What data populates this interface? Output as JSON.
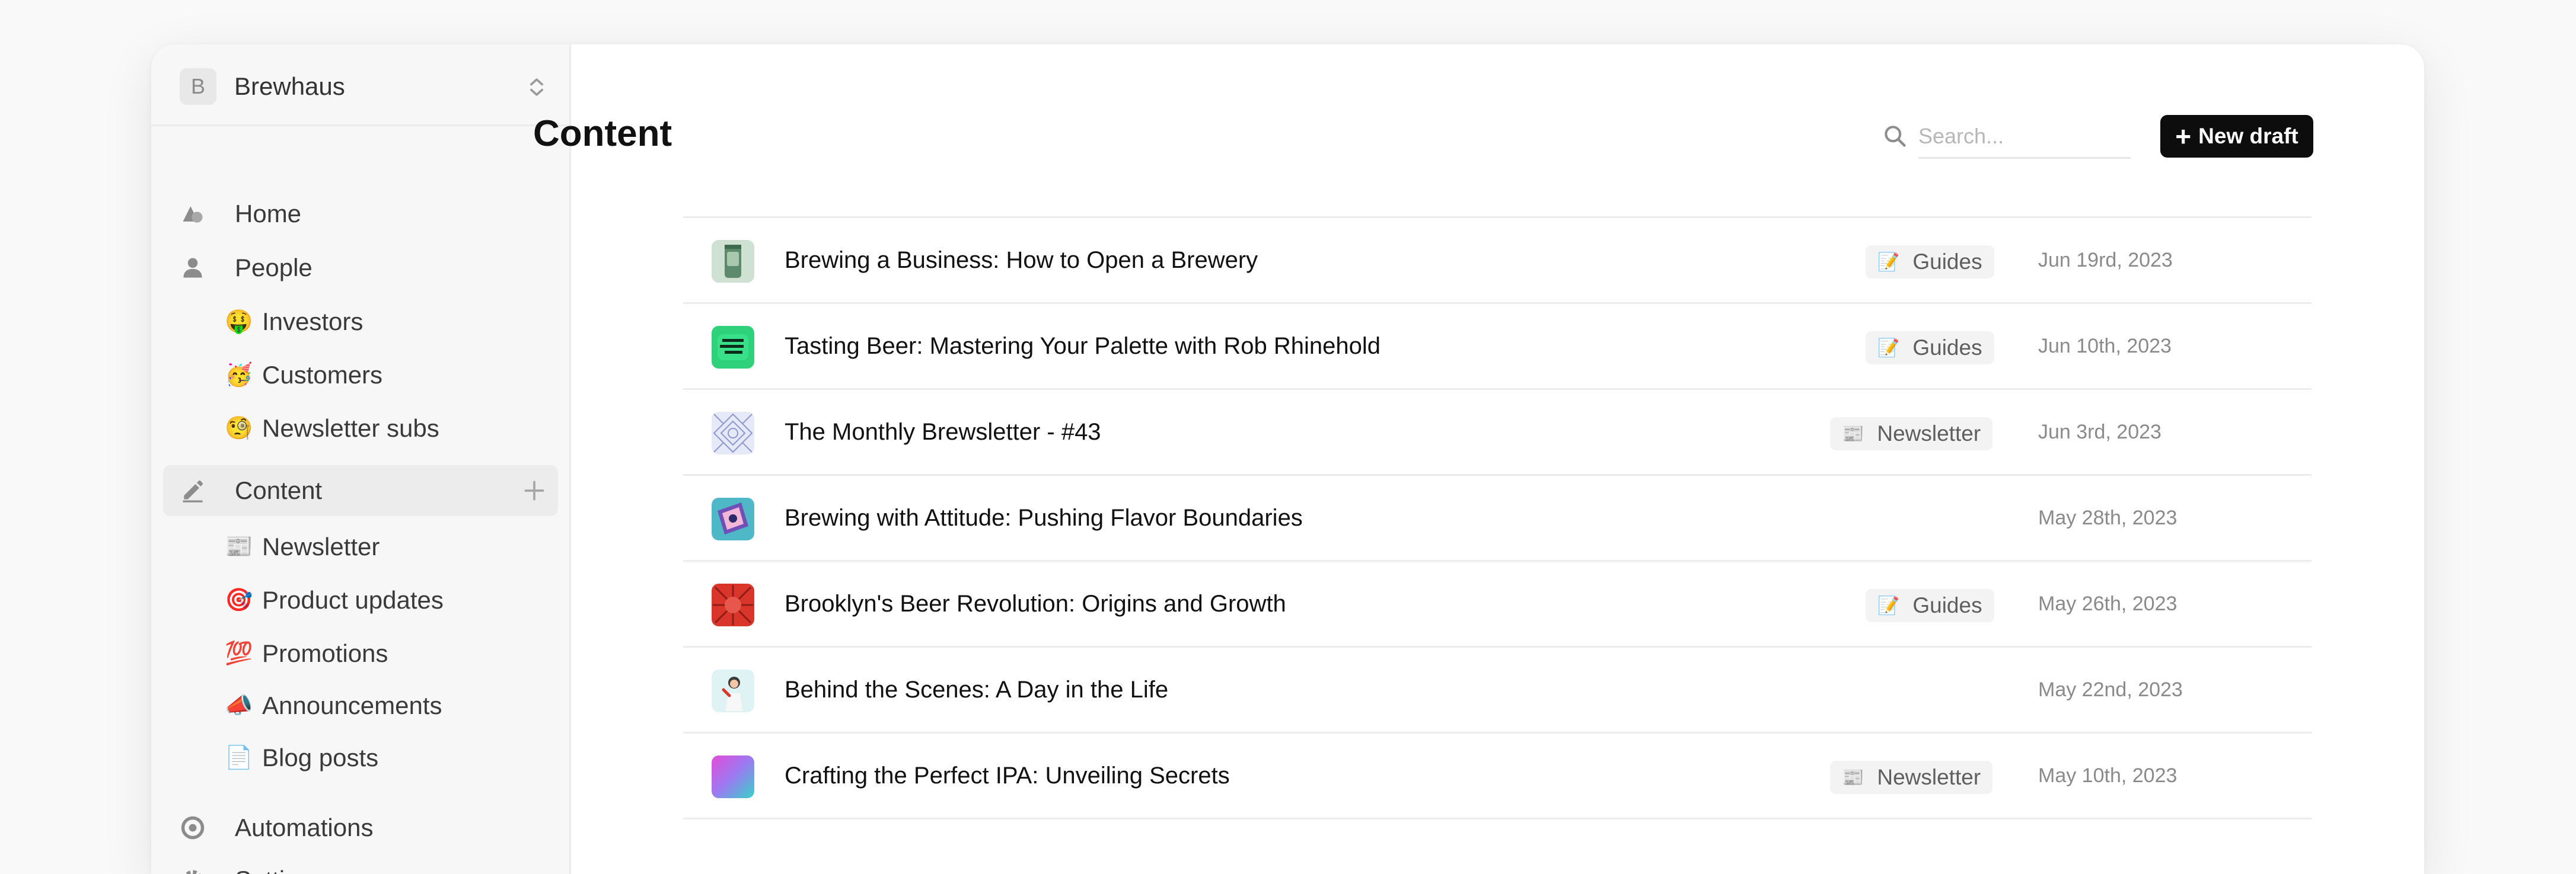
{
  "workspace": {
    "initial": "B",
    "name": "Brewhaus"
  },
  "sidebar": {
    "home_label": "Home",
    "people_label": "People",
    "people_items": [
      {
        "emoji": "🤑",
        "label": "Investors"
      },
      {
        "emoji": "🥳",
        "label": "Customers"
      },
      {
        "emoji": "🧐",
        "label": "Newsletter subs"
      }
    ],
    "content_label": "Content",
    "content_items": [
      {
        "emoji": "📰",
        "label": "Newsletter"
      },
      {
        "emoji": "🎯",
        "label": "Product updates"
      },
      {
        "emoji": "💯",
        "label": "Promotions"
      },
      {
        "emoji": "📣",
        "label": "Announcements"
      },
      {
        "emoji": "📄",
        "label": "Blog posts"
      }
    ],
    "automations_label": "Automations",
    "settings_label": "Settings"
  },
  "main": {
    "title": "Content",
    "search_placeholder": "Search...",
    "new_draft_label": "New draft",
    "rows": [
      {
        "title": "Brewing a Business: How to Open a Brewery",
        "tag_emoji": "📝",
        "tag": "Guides",
        "date": "Jun 19rd, 2023",
        "thumb": "thumb-can-icon"
      },
      {
        "title": "Tasting Beer: Mastering Your Palette with Rob Rhinehold",
        "tag_emoji": "📝",
        "tag": "Guides",
        "date": "Jun 10th, 2023",
        "thumb": "thumb-green-icon"
      },
      {
        "title": "The Monthly Brewsletter - #43",
        "tag_emoji": "📰",
        "tag": "Newsletter",
        "date": "Jun 3rd, 2023",
        "thumb": "thumb-pattern-icon"
      },
      {
        "title": "Brewing with Attitude: Pushing Flavor Boundaries",
        "tag_emoji": "",
        "tag": "",
        "date": "May 28th, 2023",
        "thumb": "thumb-sticker-icon"
      },
      {
        "title": "Brooklyn's Beer Revolution: Origins and Growth",
        "tag_emoji": "📝",
        "tag": "Guides",
        "date": "May 26th, 2023",
        "thumb": "thumb-red-icon"
      },
      {
        "title": "Behind the Scenes: A Day in the Life",
        "tag_emoji": "",
        "tag": "",
        "date": "May 22nd, 2023",
        "thumb": "thumb-illustration-icon"
      },
      {
        "title": "Crafting the Perfect IPA: Unveiling Secrets",
        "tag_emoji": "📰",
        "tag": "Newsletter",
        "date": "May 10th, 2023",
        "thumb": "thumb-gradient-icon"
      }
    ]
  },
  "colors": {
    "accent_button": "#0d0d0d",
    "active_nav_bg": "#ececec",
    "tag_bg": "#f3f3f3"
  }
}
